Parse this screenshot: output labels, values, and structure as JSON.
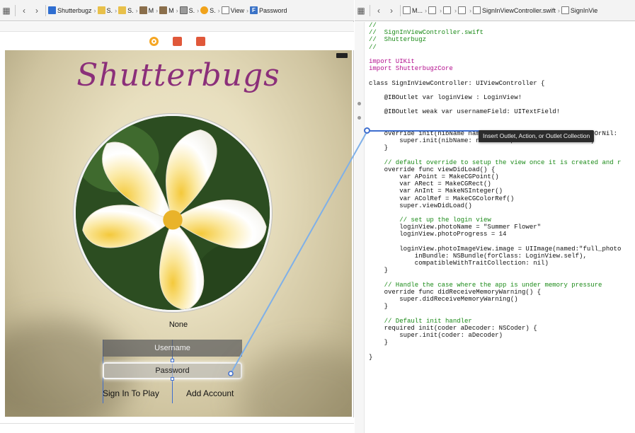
{
  "left_jumpbar": {
    "items": [
      {
        "icon": "project-icon",
        "label": "Shutterbugz"
      },
      {
        "icon": "folder-icon",
        "label": "S."
      },
      {
        "icon": "folder-icon",
        "label": "S."
      },
      {
        "icon": "storyboard-icon",
        "label": "M"
      },
      {
        "icon": "storyboard-icon",
        "label": "M"
      },
      {
        "icon": "scene-icon",
        "label": "S."
      },
      {
        "icon": "view-controller-icon",
        "label": "S."
      },
      {
        "icon": "view-icon",
        "label": "View"
      },
      {
        "icon": "text-field-icon",
        "label": "Password"
      }
    ]
  },
  "right_jumpbar": {
    "items": [
      {
        "label": "M..."
      },
      {
        "label": ""
      },
      {
        "label": ""
      },
      {
        "label": ""
      },
      {
        "label": "SignInViewController.swift"
      },
      {
        "label": "SignInVie"
      }
    ]
  },
  "device": {
    "app_title": "Shutterbugs",
    "photo_name": "None",
    "username_placeholder": "Username",
    "password_placeholder": "Password",
    "sign_in_label": "Sign In To Play",
    "add_account_label": "Add Account"
  },
  "tooltip": "Insert Outlet, Action, or Outlet Collection",
  "code_lines": [
    {
      "cls": "tok-c",
      "text": "//"
    },
    {
      "cls": "tok-c",
      "text": "//  SignInViewController.swift"
    },
    {
      "cls": "tok-c",
      "text": "//  Shutterbugz"
    },
    {
      "cls": "tok-c",
      "text": "//"
    },
    {
      "cls": "",
      "text": ""
    },
    {
      "cls": "tok-k",
      "text": "import UIKit"
    },
    {
      "cls": "tok-k",
      "text": "import ShutterbugzCore"
    },
    {
      "cls": "",
      "text": ""
    },
    {
      "cls": "",
      "text": "class SignInViewController: UIViewController {"
    },
    {
      "cls": "",
      "text": ""
    },
    {
      "cls": "",
      "text": "    @IBOutlet var loginView : LoginView!"
    },
    {
      "cls": "",
      "text": ""
    },
    {
      "cls": "",
      "text": "    @IBOutlet weak var usernameField: UITextField!"
    },
    {
      "cls": "",
      "text": ""
    },
    {
      "cls": "",
      "text": ""
    },
    {
      "cls": "",
      "text": "    override init(nibName nameOrNil: String?, bundle bundleOrNil:"
    },
    {
      "cls": "",
      "text": "        super.init(nibName: nameOrNil, bundle: bundleOrNil)"
    },
    {
      "cls": "",
      "text": "    }"
    },
    {
      "cls": "",
      "text": ""
    },
    {
      "cls": "tok-c",
      "text": "    // default override to setup the view once it is created and r"
    },
    {
      "cls": "",
      "text": "    override func viewDidLoad() {"
    },
    {
      "cls": "",
      "text": "        var APoint = MakeCGPoint()"
    },
    {
      "cls": "",
      "text": "        var ARect = MakeCGRect()"
    },
    {
      "cls": "",
      "text": "        var AnInt = MakeNSInteger()"
    },
    {
      "cls": "",
      "text": "        var AColRef = MakeCGColorRef()"
    },
    {
      "cls": "",
      "text": "        super.viewDidLoad()"
    },
    {
      "cls": "",
      "text": ""
    },
    {
      "cls": "tok-c",
      "text": "        // set up the login view"
    },
    {
      "cls": "",
      "text": "        loginView.photoName = \"Summer Flower\""
    },
    {
      "cls": "",
      "text": "        loginView.photoProgress = 14"
    },
    {
      "cls": "",
      "text": ""
    },
    {
      "cls": "",
      "text": "        loginView.photoImageView.image = UIImage(named:\"full_photo"
    },
    {
      "cls": "",
      "text": "            inBundle: NSBundle(forClass: LoginView.self),"
    },
    {
      "cls": "",
      "text": "            compatibleWithTraitCollection: nil)"
    },
    {
      "cls": "",
      "text": "    }"
    },
    {
      "cls": "",
      "text": ""
    },
    {
      "cls": "tok-c",
      "text": "    // Handle the case where the app is under memory pressure"
    },
    {
      "cls": "",
      "text": "    override func didReceiveMemoryWarning() {"
    },
    {
      "cls": "",
      "text": "        super.didReceiveMemoryWarning()"
    },
    {
      "cls": "",
      "text": "    }"
    },
    {
      "cls": "",
      "text": ""
    },
    {
      "cls": "tok-c",
      "text": "    // Default init handler"
    },
    {
      "cls": "",
      "text": "    required init(coder aDecoder: NSCoder) {"
    },
    {
      "cls": "",
      "text": "        super.init(coder: aDecoder)"
    },
    {
      "cls": "",
      "text": "    }"
    },
    {
      "cls": "",
      "text": ""
    },
    {
      "cls": "",
      "text": "}"
    }
  ],
  "colors": {
    "title_purple": "#8b2f7a",
    "connection_blue": "#3e6ecf",
    "comment_green": "#1a8a17",
    "keyword_magenta": "#b30d8d"
  }
}
